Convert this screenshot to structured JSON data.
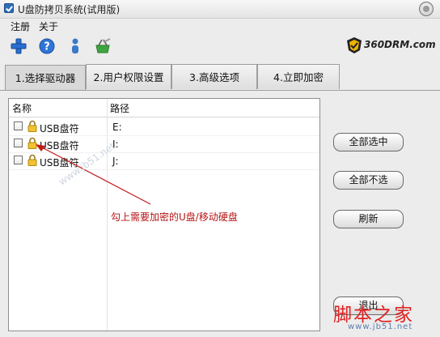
{
  "window": {
    "title": "U盘防拷贝系统(试用版)"
  },
  "menu": {
    "items": [
      "注册",
      "关于"
    ]
  },
  "toolbar": {
    "buttons": [
      {
        "icon": "plus-icon"
      },
      {
        "icon": "help-icon"
      },
      {
        "icon": "user-icon"
      },
      {
        "icon": "basket-icon"
      }
    ]
  },
  "brand": {
    "text": "360DRM.com",
    "color": "#f0b400"
  },
  "tabs": [
    {
      "label": "1.选择驱动器",
      "active": true
    },
    {
      "label": "2.用户权限设置",
      "active": false
    },
    {
      "label": "3.高级选项",
      "active": false
    },
    {
      "label": "4.立即加密",
      "active": false
    }
  ],
  "drive_list": {
    "columns": [
      "名称",
      "路径"
    ],
    "rows": [
      {
        "name": "USB盘符",
        "path": "E:",
        "checked": false
      },
      {
        "name": "USB盘符",
        "path": "I:",
        "checked": false
      },
      {
        "name": "USB盘符",
        "path": "J:",
        "checked": false
      }
    ]
  },
  "buttons": {
    "select_all": "全部选中",
    "select_none": "全部不选",
    "refresh": "刷新",
    "exit": "退出"
  },
  "annotation": {
    "text": "勾上需要加密的U盘/移动硬盘",
    "color": "#b51515"
  },
  "watermark": {
    "text": "脚本之家",
    "url": "www.jb51.net",
    "diag": "www.jb51.net"
  }
}
